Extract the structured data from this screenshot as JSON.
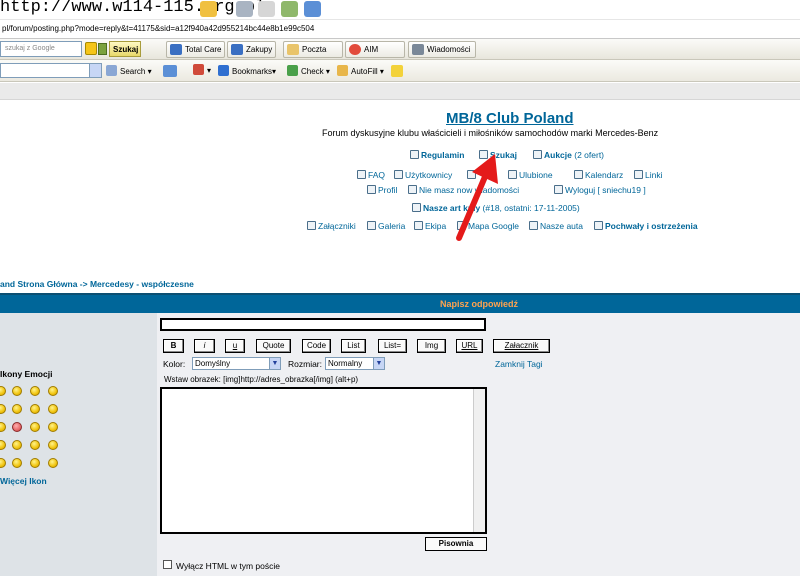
{
  "browser": {
    "title_url": "http://www.w114-115.org.pl",
    "address": "pl/forum/posting.php?mode=reply&t=41175&sid=a12f940a42d955214bc44e8b1e99c504",
    "google_toolbar": {
      "search_placeholder": "szukaj z Google",
      "search_button": "Szukaj",
      "buttons": [
        "Total Care",
        "Zakupy",
        "Poczta",
        "AIM",
        "Wiadomości"
      ]
    },
    "toolbar2": {
      "items": [
        "Search",
        "Bookmarks",
        "Check",
        "AutoFill"
      ]
    },
    "colors": {
      "link": "#006699",
      "header_bar": "#006699",
      "header_text": "#ffa34f",
      "panel_left": "#dee3e7",
      "panel_right": "#eff0f3",
      "arrow": "#e41a1a"
    }
  },
  "site": {
    "title": "MB/8 Club Poland",
    "description": "Forum dyskusyjne klubu właścicieli i miłośników samochodów marki Mercedes-Benz",
    "nav": {
      "regulamin": "Regulamin",
      "szukaj": "Szukaj",
      "aukcje": "Aukcje",
      "aukcje_count": "(2 ofert)",
      "faq": "FAQ",
      "uzytkownicy": "Użytkownicy",
      "grupy": "y",
      "ulubione": "Ulubione",
      "kalendarz": "Kalendarz",
      "linki": "Linki",
      "profil": "Profil",
      "wiadomosci": "Nie masz now wiadomości",
      "wyloguj": "Wyloguj [ sniechu19 ]",
      "artykuly": "Nasze art kuły",
      "artykuly_info": "(#18, ostatni: 17-11-2005)",
      "zalaczniki": "Załączniki",
      "galeria": "Galeria",
      "ekipa": "Ekipa",
      "mapa": "Mapa Google",
      "auta": "Nasze auta",
      "pochwaly": "Pochwały i ostrzeżenia"
    }
  },
  "breadcrumb": "and Strona Główna -> Mercedesy - współczesne",
  "post": {
    "header": "Napisz odpowiedź",
    "bbcode_buttons": [
      "B",
      "i",
      "u",
      "Quote",
      "Code",
      "List",
      "List=",
      "Img",
      "URL",
      "Załacznik"
    ],
    "kolor_label": "Kolor:",
    "kolor_value": "Domyślny",
    "rozmiar_label": "Rozmiar:",
    "rozmiar_value": "Normalny",
    "zamknij_tagi": "Zamknij Tagi",
    "hint": "Wstaw obrazek: [img]http://adres_obrazka[/img]  (alt+p)",
    "pisownia": "Pisownia",
    "html_checkbox": "Wyłącz HTML w tym poście"
  },
  "emoticons": {
    "title": "Ikony Emocji",
    "more": "Więcej Ikon"
  }
}
